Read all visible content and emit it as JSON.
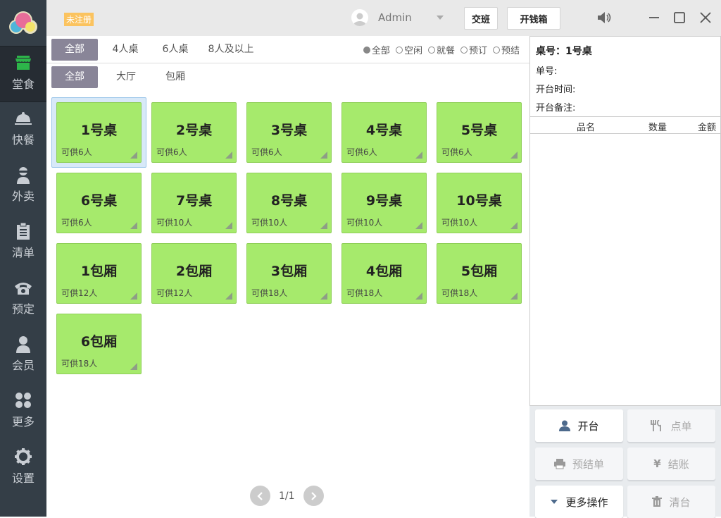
{
  "sidebar": {
    "items": [
      {
        "label": "堂食",
        "icon": "store-icon",
        "active": true
      },
      {
        "label": "快餐",
        "icon": "cloche-icon"
      },
      {
        "label": "外卖",
        "icon": "delivery-person-icon"
      },
      {
        "label": "清单",
        "icon": "clipboard-icon"
      },
      {
        "label": "预定",
        "icon": "telephone-icon"
      },
      {
        "label": "会员",
        "icon": "user-icon"
      },
      {
        "label": "更多",
        "icon": "grid-icon"
      },
      {
        "label": "设置",
        "icon": "gear-icon"
      }
    ]
  },
  "topbar": {
    "unregistered": "未注册",
    "user": "Admin",
    "shift_button": "交班",
    "cash_drawer_button": "开钱箱"
  },
  "filters": {
    "sizes": [
      "全部",
      "4人桌",
      "6人桌",
      "8人及以上"
    ],
    "areas": [
      "全部",
      "大厅",
      "包厢"
    ],
    "status": [
      "全部",
      "空闲",
      "就餐",
      "预订",
      "预结"
    ]
  },
  "tables": [
    {
      "name": "1号桌",
      "cap": "可供6人"
    },
    {
      "name": "2号桌",
      "cap": "可供6人"
    },
    {
      "name": "3号桌",
      "cap": "可供6人"
    },
    {
      "name": "4号桌",
      "cap": "可供6人"
    },
    {
      "name": "5号桌",
      "cap": "可供6人"
    },
    {
      "name": "6号桌",
      "cap": "可供6人"
    },
    {
      "name": "7号桌",
      "cap": "可供10人"
    },
    {
      "name": "8号桌",
      "cap": "可供10人"
    },
    {
      "name": "9号桌",
      "cap": "可供10人"
    },
    {
      "name": "10号桌",
      "cap": "可供10人"
    },
    {
      "name": "1包厢",
      "cap": "可供12人"
    },
    {
      "name": "2包厢",
      "cap": "可供12人"
    },
    {
      "name": "3包厢",
      "cap": "可供18人"
    },
    {
      "name": "4包厢",
      "cap": "可供18人"
    },
    {
      "name": "5包厢",
      "cap": "可供18人"
    },
    {
      "name": "6包厢",
      "cap": "可供18人"
    }
  ],
  "pager": {
    "text": "1/1"
  },
  "detail": {
    "table": "桌号：1号桌",
    "order_no": "单号:",
    "open_time": "开台时间:",
    "note": "开台备注:",
    "columns": [
      "品名",
      "数量",
      "金额"
    ]
  },
  "actions": [
    "开台",
    "点单",
    "预结单",
    "结账",
    "更多操作",
    "清台"
  ],
  "colors": {
    "sidebar": "#343e47",
    "card": "#a6ea6c",
    "chip": "#898598",
    "badge": "#fbc35f"
  }
}
